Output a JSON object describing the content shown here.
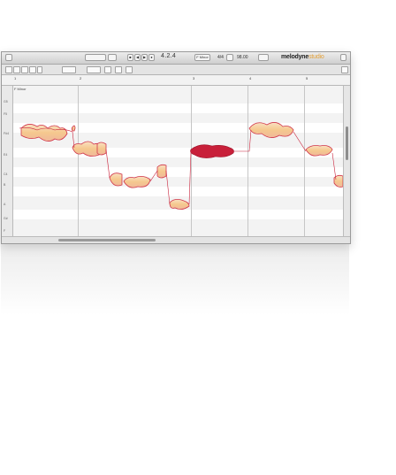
{
  "toolbar": {
    "position": "4.2.4",
    "key": "F Minor",
    "meter": "4/4",
    "tempo": "98.00",
    "logo_main": "melodyne",
    "logo_edition": "studio"
  },
  "ruler": {
    "bars": [
      "1",
      "2",
      "3",
      "4",
      "5"
    ],
    "scale_label": "F Minor"
  },
  "keys": [
    "G5",
    "F5",
    "F#4",
    "E4",
    "C4",
    "B",
    "A",
    "G#",
    "F"
  ],
  "colors": {
    "note_fill": "#f6d8a8",
    "note_outline": "#d0354a",
    "selected_note": "#c8203a",
    "accent": "#e3a13a"
  }
}
